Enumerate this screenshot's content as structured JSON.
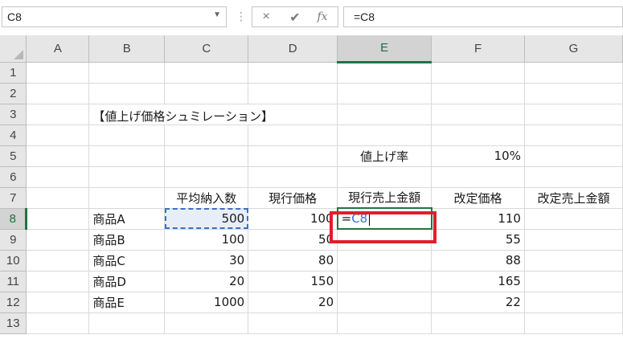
{
  "formula_bar": {
    "name_box": "C8",
    "formula": "=C8",
    "cancel_icon": "×",
    "enter_icon": "✔",
    "fx_icon": "fx"
  },
  "columns": [
    "A",
    "B",
    "C",
    "D",
    "E",
    "F",
    "G"
  ],
  "rows": [
    "1",
    "2",
    "3",
    "4",
    "5",
    "6",
    "7",
    "8",
    "9",
    "10",
    "11",
    "12",
    "13"
  ],
  "cells": {
    "B3": "【値上げ価格シュミレーション】",
    "E5": "値上げ率",
    "F5": "10%",
    "C7": "平均納入数",
    "D7": "現行価格",
    "E7": "現行売上金額",
    "F7": "改定価格",
    "G7": "改定売上金額",
    "B8": "商品A",
    "C8": "500",
    "D8": "100",
    "E8_prefix": "=",
    "E8_ref": "C8",
    "F8": "110",
    "B9": "商品B",
    "C9": "100",
    "D9": "50",
    "F9": "55",
    "B10": "商品C",
    "C10": "30",
    "D10": "80",
    "F10": "88",
    "B11": "商品D",
    "C11": "20",
    "D11": "150",
    "F11": "165",
    "B12": "商品E",
    "C12": "1000",
    "D12": "20",
    "F12": "22"
  },
  "colors": {
    "highlight_box": "#e11e2d",
    "selection_green": "#217346",
    "reference_blue": "#3b6fc5"
  }
}
